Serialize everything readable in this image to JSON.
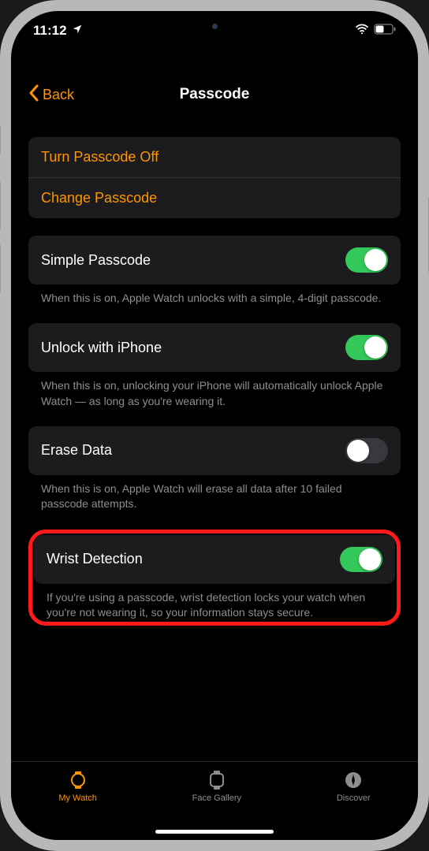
{
  "statusBar": {
    "time": "11:12"
  },
  "nav": {
    "back": "Back",
    "title": "Passcode"
  },
  "actionGroup": {
    "turnOff": "Turn Passcode Off",
    "change": "Change Passcode"
  },
  "simplePasscode": {
    "label": "Simple Passcode",
    "on": true,
    "footer": "When this is on, Apple Watch unlocks with a simple, 4-digit passcode."
  },
  "unlockIphone": {
    "label": "Unlock with iPhone",
    "on": true,
    "footer": "When this is on, unlocking your iPhone will automatically unlock Apple Watch — as long as you're wearing it."
  },
  "eraseData": {
    "label": "Erase Data",
    "on": false,
    "footer": "When this is on, Apple Watch will erase all data after 10 failed passcode attempts."
  },
  "wristDetection": {
    "label": "Wrist Detection",
    "on": true,
    "footer": "If you're using a passcode, wrist detection locks your watch when you're not wearing it, so your information stays secure."
  },
  "tabs": {
    "myWatch": "My Watch",
    "faceGallery": "Face Gallery",
    "discover": "Discover"
  },
  "colors": {
    "accent": "#ff9500",
    "toggleOn": "#34c759"
  }
}
